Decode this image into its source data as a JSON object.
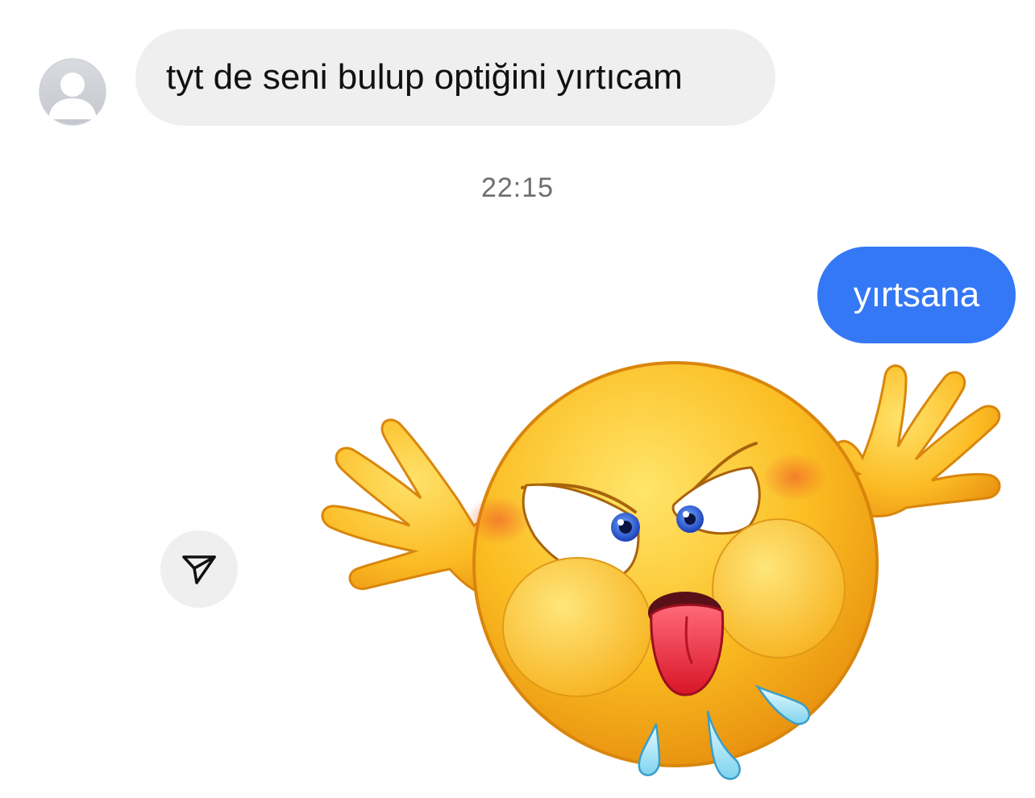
{
  "thread": {
    "incoming": {
      "text": "tyt de seni bulup optiğini yırtıcam",
      "avatar_icon": "default-avatar-icon"
    },
    "timestamp": "22:15",
    "outgoing": {
      "text": "yırtsana"
    },
    "sticker": {
      "icon": "angry-emoji-tongue-out-sticker"
    },
    "share_icon": "paper-plane-share-icon"
  },
  "colors": {
    "incoming_bubble": "#efefef",
    "outgoing_bubble": "#3478f6",
    "emoji_yellow": "#f9b11b",
    "tongue_red": "#e8263a"
  }
}
